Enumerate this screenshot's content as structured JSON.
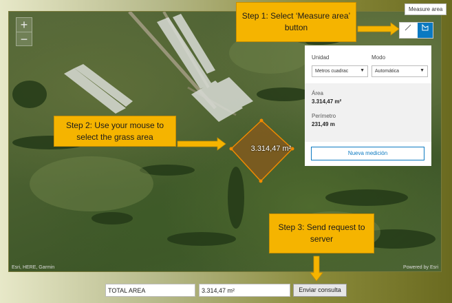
{
  "map": {
    "zoom_in": "+",
    "zoom_out": "−",
    "attribution_left": "Esri, HERE, Garmin",
    "attribution_right": "Powered by Esri",
    "area_label": "3.314,47 m²",
    "polygon_color": "#8a5a1c",
    "polygon_stroke": "#f08a00"
  },
  "measure": {
    "tooltip": "Measure area",
    "distance_icon": "ruler-icon",
    "area_icon": "area-measure-icon",
    "accent": "#0a79c1",
    "panel": {
      "unit_label": "Unidad",
      "mode_label": "Modo",
      "unit_value": "Metros cuadrac",
      "mode_value": "Automática",
      "area_label": "Área",
      "area_value": "3.314,47 m²",
      "perimeter_label": "Perímetro",
      "perimeter_value": "231,49 m",
      "new_measurement": "Nueva medición"
    }
  },
  "callouts": {
    "step1": "Step 1: Select ‘Measure area’ button",
    "step2": "Step 2: Use your mouse to select the grass area",
    "step3": "Step 3: Send request to server",
    "color": "#f5b400"
  },
  "form": {
    "total_label": "TOTAL AREA",
    "total_value": "3.314,47 m²",
    "submit": "Enviar consulta"
  }
}
